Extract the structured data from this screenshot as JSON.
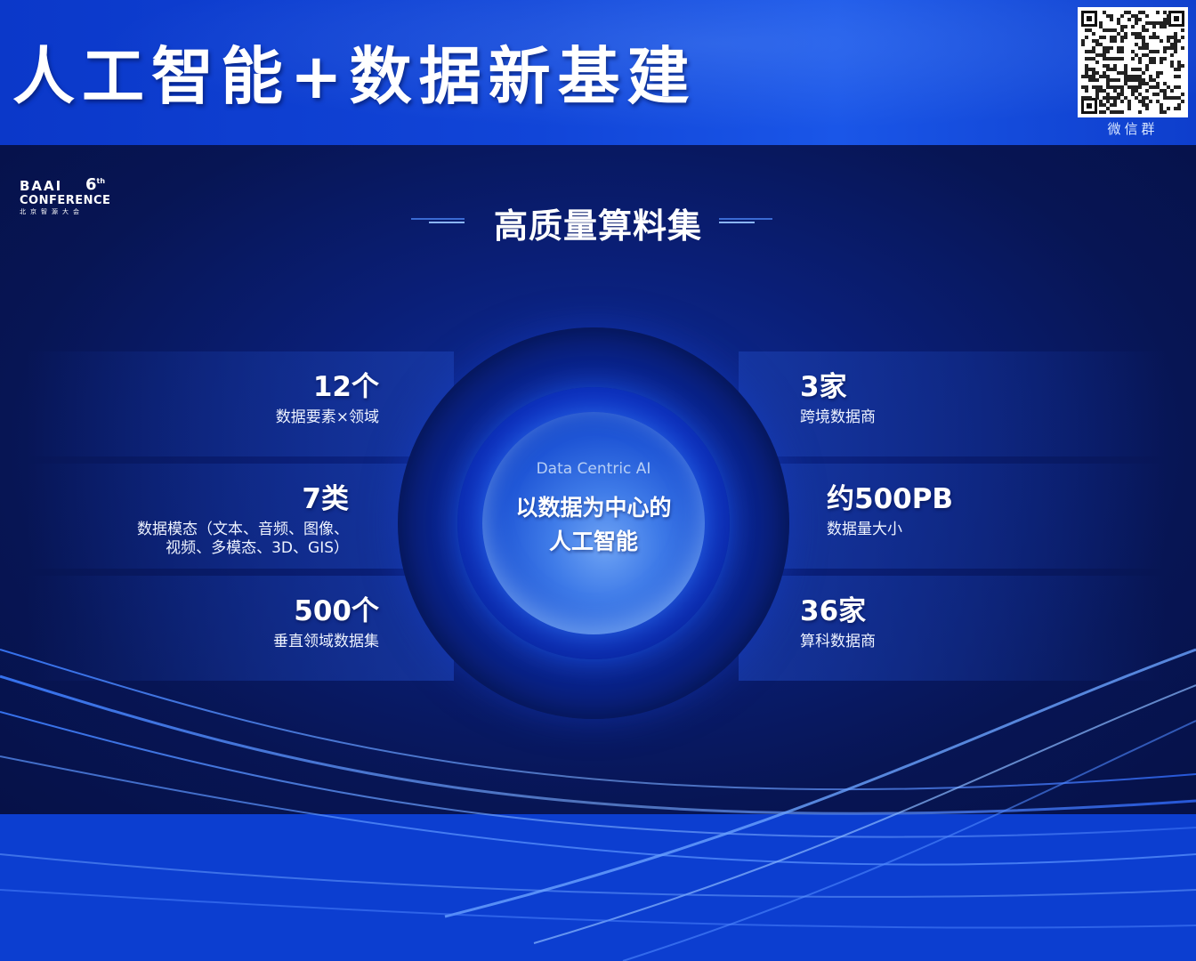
{
  "header": {
    "title": "人工智能+数据新基建",
    "qr_caption": "微信群"
  },
  "logo": {
    "brand": "BAAI",
    "edition": "6",
    "edition_suffix": "th",
    "name": "CONFERENCE",
    "subtitle": "北京智源大会"
  },
  "slide": {
    "section_title": "高质量算料集",
    "center": {
      "subtitle": "Data Centric AI",
      "line1": "以数据为中心的",
      "line2": "人工智能"
    },
    "left_stats": [
      {
        "number": "12个",
        "desc": "数据要素×领域"
      },
      {
        "number": "7类",
        "desc_line1": "数据模态（文本、音频、图像、",
        "desc_line2": "视频、多模态、3D、GIS）"
      },
      {
        "number": "500个",
        "desc": "垂直领域数据集"
      }
    ],
    "right_stats": [
      {
        "number": "3家",
        "desc": "跨境数据商"
      },
      {
        "number": "约500PB",
        "desc": "数据量大小"
      },
      {
        "number": "36家",
        "desc": "算科数据商"
      }
    ]
  },
  "colors": {
    "header_blue": "#0b38c9",
    "slide_navy": "#071554",
    "core_blue": "#3f7be8",
    "text_white": "#ffffff"
  }
}
